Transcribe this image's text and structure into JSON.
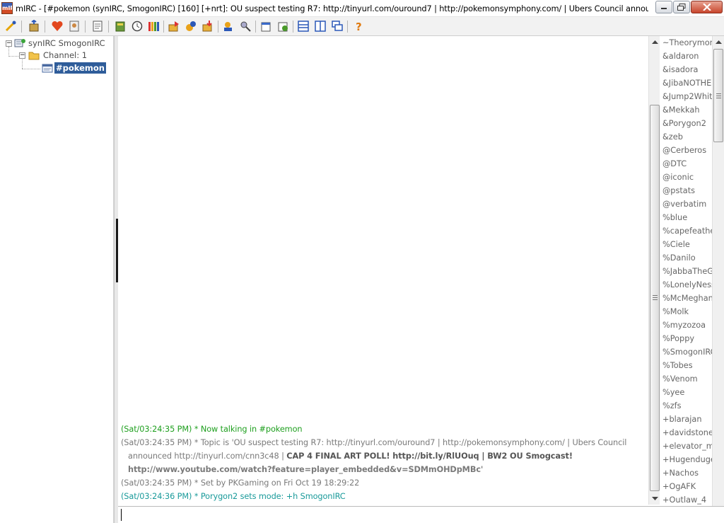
{
  "window": {
    "title": "mIRC - [#pokemon (synIRC, SmogonIRC) [160] [+nrt]: OU suspect testing R7: http://tinyurl.com/ouround7 | http://pokemonsymphony.com/ | Ubers Council announc...",
    "app_icon_text": "mIRC"
  },
  "toolbar": {
    "buttons": [
      "connect-icon",
      "options-icon",
      "favorites-icon",
      "address-book-icon",
      "scripts-editor-icon",
      "channels-list-icon",
      "timer-icon",
      "colors-icon",
      "send-file-icon",
      "dcc-chat-icon",
      "received-files-icon",
      "notify-list-icon",
      "url-catcher-icon",
      "log-icon",
      "cascade-icon",
      "tile-horizontal-icon",
      "tile-vertical-icon",
      "arrange-icon",
      "help-icon"
    ]
  },
  "tree": {
    "network": "synIRC SmogonIRC",
    "folder": "Channel: 1",
    "channel": "#pokemon"
  },
  "chat": {
    "lines": [
      {
        "text": "(Sat/03:24:35 PM) * Now talking in #pokemon",
        "color": "#1e9f1e"
      },
      {
        "text": "(Sat/03:24:35 PM) * Topic is 'OU suspect testing R7: http://tinyurl.com/ouround7 | http://pokemonsymphony.com/ | Ubers Council",
        "color": "#7a7a7a"
      },
      {
        "text_a": "announced http://tinyurl.com/cnn3c48 | ",
        "text_b": "CAP 4 FINAL ART POLL! http://bit.ly/RlUOuq | BW2 OU Smogcast!",
        "color": "#7a7a7a"
      },
      {
        "text": "http://www.youtube.com/watch?feature=player_embedded&v=SDMmOHDpMBc'",
        "color": "#7a7a7a"
      },
      {
        "text": "(Sat/03:24:35 PM) * Set by PKGaming on Fri Oct 19 18:29:22",
        "color": "#7a7a7a"
      },
      {
        "text": "(Sat/03:24:36 PM) * Porygon2 sets mode: +h SmogonIRC",
        "color": "#199a9a"
      }
    ]
  },
  "nicklist": [
    "~Theorymon",
    "&aldaron",
    "&isadora",
    "&JibaNOTHE",
    "&Jump2Whit",
    "&Mekkah",
    "&Porygon2",
    "&zeb",
    "@Cerberos",
    "@DTC",
    "@iconic",
    "@pstats",
    "@verbatim",
    "%blue",
    "%capefeathe",
    "%Ciele",
    "%Danilo",
    "%JabbaTheG",
    "%LonelyNess",
    "%McMeghan",
    "%Molk",
    "%myzozoa",
    "%Poppy",
    "%SmogonIRC",
    "%Tobes",
    "%Venom",
    "%yee",
    "%zfs",
    "+blarajan",
    "+davidstone",
    "+elevator_mu",
    "+Hugenduge",
    "+Nachos",
    "+OgAFK",
    "+Outlaw_4"
  ],
  "editbox": {
    "value": ""
  },
  "colors": {
    "accent": "#2f5d9a",
    "join": "#1e9f1e",
    "topic": "#7a7a7a",
    "mode": "#199a9a"
  }
}
